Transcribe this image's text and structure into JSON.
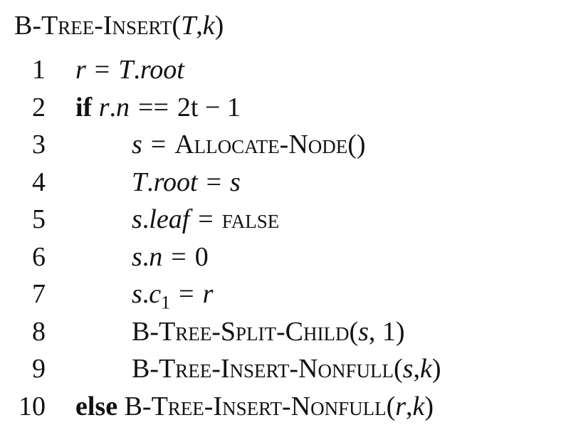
{
  "title": {
    "proc": "B-Tree-Insert",
    "lparen": "(",
    "arg1": "T",
    "comma": ",",
    "arg2": "k",
    "rparen": ")"
  },
  "lines": [
    {
      "num": "1"
    },
    {
      "num": "2",
      "kw": "if"
    },
    {
      "num": "3"
    },
    {
      "num": "4"
    },
    {
      "num": "5"
    },
    {
      "num": "6"
    },
    {
      "num": "7"
    },
    {
      "num": "8"
    },
    {
      "num": "9"
    },
    {
      "num": "10",
      "kw": "else"
    }
  ],
  "tokens": {
    "r": "r",
    "s": "s",
    "T": "T",
    "k": "k",
    "eq": "=",
    "deq": "==",
    "root": "root",
    "n": "n",
    "dot": ".",
    "two_t": "2t",
    "minus_one": "− 1",
    "allocate": "Allocate-Node",
    "empty_parens": "()",
    "leaf": "leaf",
    "false": "false",
    "zero": "0",
    "c": "c",
    "one": "1",
    "split": "B-Tree-Split-Child",
    "insert_nonfull": "B-Tree-Insert-Nonfull",
    "lparen": "(",
    "rparen": ")",
    "comma": ","
  }
}
